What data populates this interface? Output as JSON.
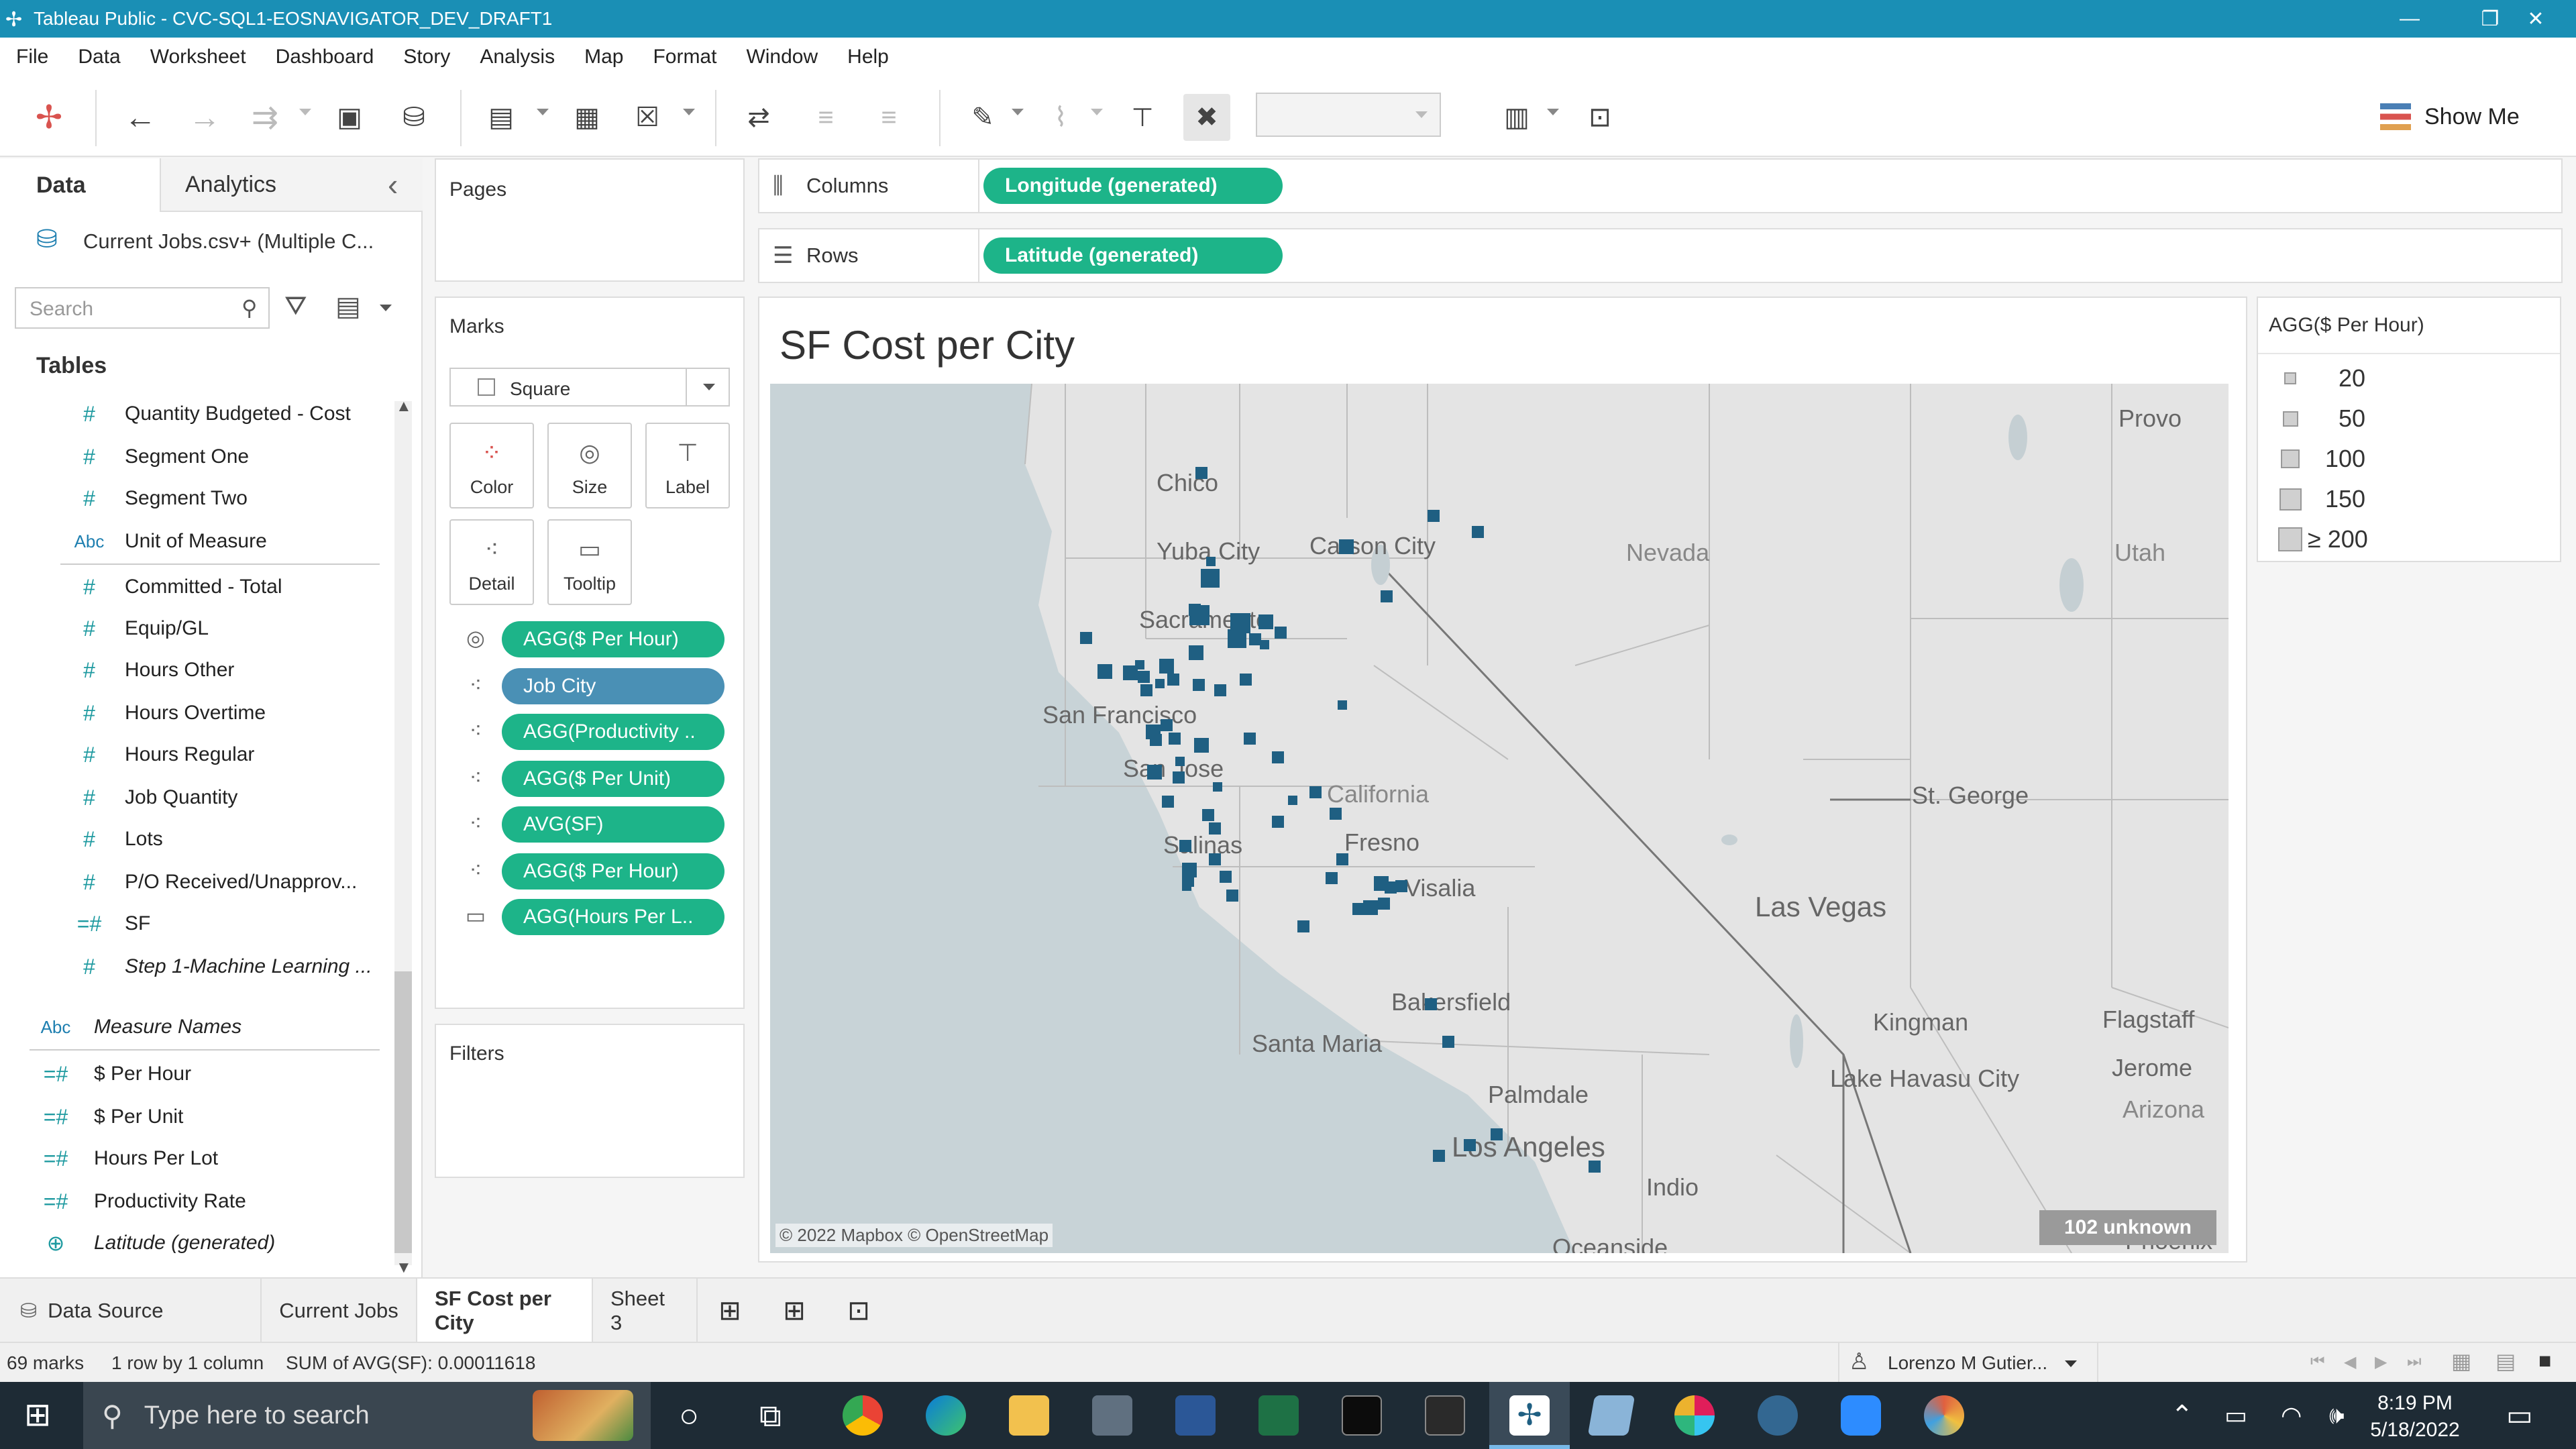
{
  "app": {
    "window_title": "Tableau Public - CVC-SQL1-EOSNAVIGATOR_DEV_DRAFT1",
    "window_controls": {
      "minimize": "—",
      "maximize": "❐",
      "close": "✕"
    }
  },
  "menu": [
    "File",
    "Data",
    "Worksheet",
    "Dashboard",
    "Story",
    "Analysis",
    "Map",
    "Format",
    "Window",
    "Help"
  ],
  "toolbar": {
    "show_me": "Show Me"
  },
  "data_pane": {
    "tab_data": "Data",
    "tab_analytics": "Analytics",
    "collapse_glyph": "‹",
    "datasource": "Current Jobs.csv+ (Multiple C...",
    "search_placeholder": "Search",
    "tables_header": "Tables",
    "fields": [
      {
        "icon": "#",
        "label": "Quantity Budgeted - Cost"
      },
      {
        "icon": "#",
        "label": "Segment One"
      },
      {
        "icon": "#",
        "label": "Segment Two"
      },
      {
        "icon": "Abc",
        "label": "Unit of Measure"
      },
      {
        "icon": "#",
        "label": "Committed - Total"
      },
      {
        "icon": "#",
        "label": "Equip/GL"
      },
      {
        "icon": "#",
        "label": "Hours Other"
      },
      {
        "icon": "#",
        "label": "Hours Overtime"
      },
      {
        "icon": "#",
        "label": "Hours Regular"
      },
      {
        "icon": "#",
        "label": "Job Quantity"
      },
      {
        "icon": "#",
        "label": "Lots"
      },
      {
        "icon": "#",
        "label": "P/O Received/Unapprov..."
      },
      {
        "icon": "=#",
        "label": "SF"
      },
      {
        "icon": "#",
        "label": "Step 1-Machine Learning ..."
      }
    ],
    "measure_names": {
      "icon": "Abc",
      "label": "Measure Names"
    },
    "calc_fields": [
      {
        "icon": "=#",
        "label": "$ Per Hour"
      },
      {
        "icon": "=#",
        "label": "$ Per Unit"
      },
      {
        "icon": "=#",
        "label": "Hours Per Lot"
      },
      {
        "icon": "=#",
        "label": "Productivity Rate"
      },
      {
        "icon": "⊕",
        "label": "Latitude (generated)"
      }
    ]
  },
  "pages_card": {
    "title": "Pages"
  },
  "marks_card": {
    "title": "Marks",
    "mark_type": "Square",
    "buttons": [
      "Color",
      "Size",
      "Label",
      "Detail",
      "Tooltip"
    ],
    "pills": [
      {
        "icon": "size",
        "label": "AGG($ Per Hour)",
        "color": "#1db489"
      },
      {
        "icon": "detail",
        "label": "Job City",
        "color": "#4a90b5"
      },
      {
        "icon": "detail",
        "label": "AGG(Productivity ..",
        "color": "#1db489"
      },
      {
        "icon": "detail",
        "label": "AGG($ Per Unit)",
        "color": "#1db489"
      },
      {
        "icon": "detail",
        "label": "AVG(SF)",
        "color": "#1db489"
      },
      {
        "icon": "detail",
        "label": "AGG($ Per Hour)",
        "color": "#1db489"
      },
      {
        "icon": "tooltip",
        "label": "AGG(Hours Per L..",
        "color": "#1db489"
      }
    ]
  },
  "filters_card": {
    "title": "Filters"
  },
  "shelves": {
    "columns_label": "Columns",
    "columns_pill": "Longitude (generated)",
    "rows_label": "Rows",
    "rows_pill": "Latitude (generated)"
  },
  "sheet": {
    "title": "SF Cost per City",
    "attribution": "© 2022 Mapbox © OpenStreetMap",
    "unknown_badge": "102 unknown",
    "mark_color": "#1f5f82",
    "map_labels": [
      "Chico",
      "Yuba City",
      "Carson City",
      "Nevada",
      "Sacramento",
      "San Francisco",
      "San Jose",
      "California",
      "Fresno",
      "Salinas",
      "Visalia",
      "Bakersfield",
      "Santa Maria",
      "Palmdale",
      "Los Angeles",
      "Las Vegas",
      "Kingman",
      "Lake Havasu City",
      "Flagstaff",
      "Jerome",
      "Arizona",
      "St. George",
      "Provo",
      "Utah",
      "Indio",
      "Oceanside",
      "Phoenix"
    ]
  },
  "legend": {
    "title": "AGG($ Per Hour)",
    "items": [
      {
        "label": "20",
        "value": 20
      },
      {
        "label": "50",
        "value": 50
      },
      {
        "label": "100",
        "value": 100
      },
      {
        "label": "150",
        "value": 150
      },
      {
        "label": "≥ 200",
        "value": 200
      }
    ]
  },
  "tabs": [
    {
      "label": "Data Source",
      "active": false
    },
    {
      "label": "Current Jobs",
      "active": false
    },
    {
      "label": "SF Cost per City",
      "active": true
    },
    {
      "label": "Sheet 3",
      "active": false
    }
  ],
  "status": {
    "marks": "69 marks",
    "dims": "1 row by 1 column",
    "sum": "SUM of AVG(SF): 0.00011618",
    "user": "Lorenzo M Gutier..."
  },
  "taskbar": {
    "search_placeholder": "Type here to search",
    "time": "8:19 PM",
    "date": "5/18/2022"
  }
}
